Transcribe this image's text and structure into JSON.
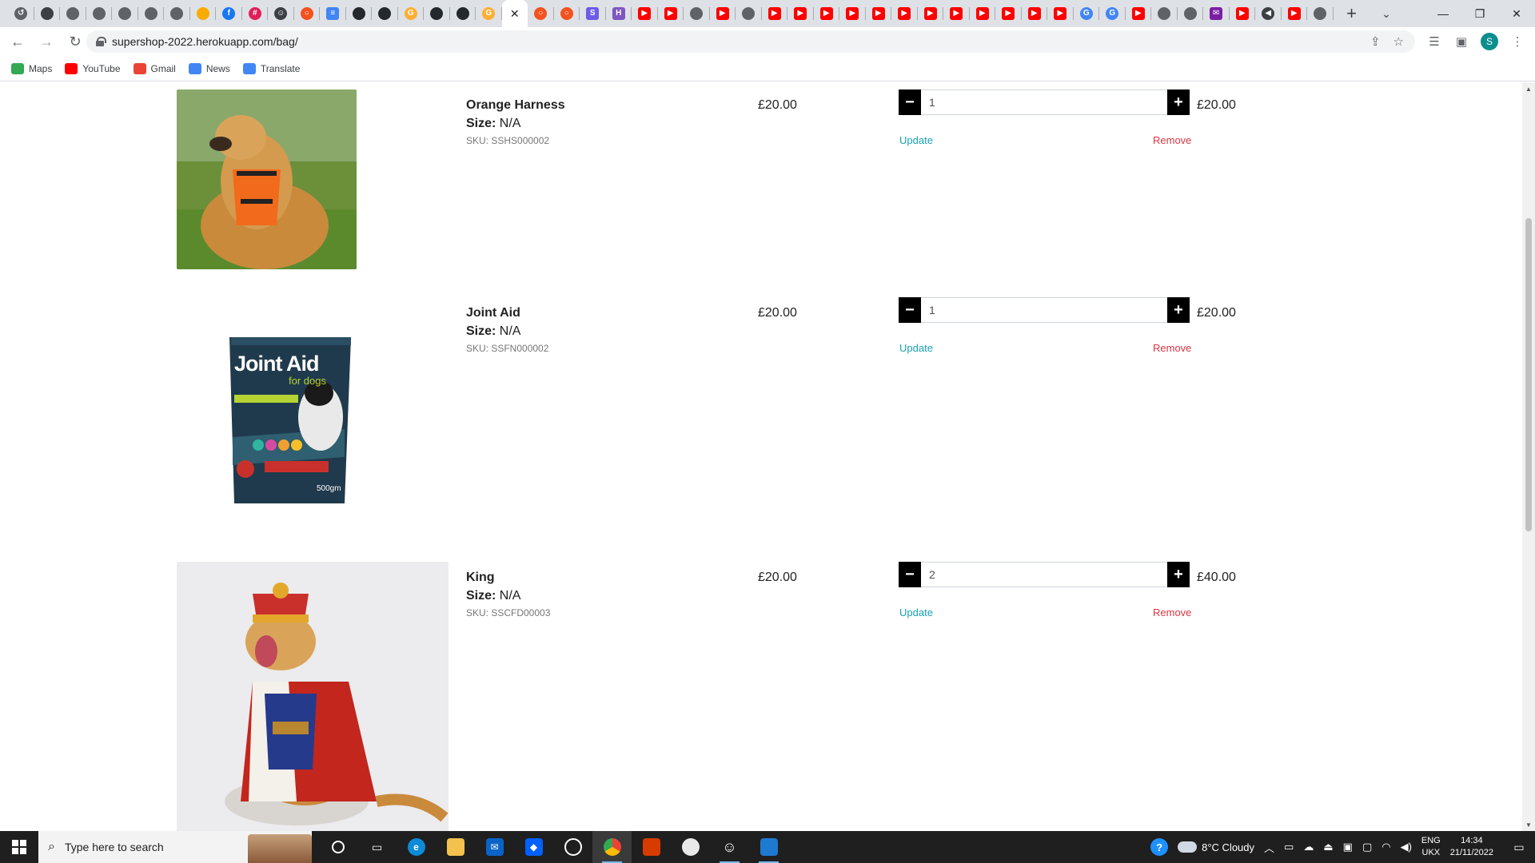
{
  "browser": {
    "tabs": [
      {
        "icon": "history-icon",
        "color": "#5f6368",
        "glyph": "↺"
      },
      {
        "icon": "circle-icon",
        "color": "#3c4043",
        "glyph": ""
      },
      {
        "icon": "chrome-gray-icon",
        "color": "#5f6368",
        "glyph": ""
      },
      {
        "icon": "chrome-gray-icon",
        "color": "#5f6368",
        "glyph": ""
      },
      {
        "icon": "chrome-gray-icon",
        "color": "#5f6368",
        "glyph": ""
      },
      {
        "icon": "chrome-gray-icon",
        "color": "#5f6368",
        "glyph": ""
      },
      {
        "icon": "chrome-gray-icon",
        "color": "#5f6368",
        "glyph": ""
      },
      {
        "icon": "orange-dot-icon",
        "color": "#f9ab00",
        "glyph": ""
      },
      {
        "icon": "facebook-icon",
        "color": "#1877f2",
        "glyph": "f"
      },
      {
        "icon": "slack-icon",
        "color": "#e01e5a",
        "glyph": "#"
      },
      {
        "icon": "smiley-icon",
        "color": "#3c4043",
        "glyph": "☺"
      },
      {
        "icon": "ring-orange-icon",
        "color": "#f4511e",
        "glyph": "○"
      },
      {
        "icon": "docs-icon",
        "color": "#4285f4",
        "glyph": "≡"
      },
      {
        "icon": "github-icon",
        "color": "#24292e",
        "glyph": ""
      },
      {
        "icon": "github-icon",
        "color": "#24292e",
        "glyph": ""
      },
      {
        "icon": "gitpod-icon",
        "color": "#ffae33",
        "glyph": "G"
      },
      {
        "icon": "github-icon",
        "color": "#24292e",
        "glyph": ""
      },
      {
        "icon": "github-icon",
        "color": "#24292e",
        "glyph": ""
      },
      {
        "icon": "gitpod-icon",
        "color": "#ffae33",
        "glyph": "G"
      },
      {
        "icon": "close-icon",
        "color": "#ffffff",
        "glyph": "✕",
        "active": true
      },
      {
        "icon": "ring-orange-icon",
        "color": "#f4511e",
        "glyph": "○"
      },
      {
        "icon": "ring-orange-icon",
        "color": "#f4511e",
        "glyph": "○"
      },
      {
        "icon": "s-icon",
        "color": "#6c5ce7",
        "glyph": "S"
      },
      {
        "icon": "h-icon",
        "color": "#7e57c2",
        "glyph": "H"
      },
      {
        "icon": "youtube-icon",
        "color": "#ff0000",
        "glyph": "▶"
      },
      {
        "icon": "youtube-icon",
        "color": "#ff0000",
        "glyph": "▶"
      },
      {
        "icon": "chrome-gray-icon",
        "color": "#5f6368",
        "glyph": ""
      },
      {
        "icon": "youtube-icon",
        "color": "#ff0000",
        "glyph": "▶"
      },
      {
        "icon": "chrome-gray-icon",
        "color": "#5f6368",
        "glyph": ""
      },
      {
        "icon": "youtube-icon",
        "color": "#ff0000",
        "glyph": "▶"
      },
      {
        "icon": "youtube-icon",
        "color": "#ff0000",
        "glyph": "▶"
      },
      {
        "icon": "youtube-icon",
        "color": "#ff0000",
        "glyph": "▶"
      },
      {
        "icon": "youtube-icon",
        "color": "#ff0000",
        "glyph": "▶"
      },
      {
        "icon": "youtube-icon",
        "color": "#ff0000",
        "glyph": "▶"
      },
      {
        "icon": "youtube-icon",
        "color": "#ff0000",
        "glyph": "▶"
      },
      {
        "icon": "youtube-icon",
        "color": "#ff0000",
        "glyph": "▶"
      },
      {
        "icon": "youtube-icon",
        "color": "#ff0000",
        "glyph": "▶"
      },
      {
        "icon": "youtube-icon",
        "color": "#ff0000",
        "glyph": "▶"
      },
      {
        "icon": "youtube-icon",
        "color": "#ff0000",
        "glyph": "▶"
      },
      {
        "icon": "youtube-icon",
        "color": "#ff0000",
        "glyph": "▶"
      },
      {
        "icon": "youtube-icon",
        "color": "#ff0000",
        "glyph": "▶"
      },
      {
        "icon": "google-icon",
        "color": "#4285f4",
        "glyph": "G"
      },
      {
        "icon": "google-icon",
        "color": "#4285f4",
        "glyph": "G"
      },
      {
        "icon": "youtube-icon",
        "color": "#ff0000",
        "glyph": "▶"
      },
      {
        "icon": "chrome-gray-icon",
        "color": "#5f6368",
        "glyph": ""
      },
      {
        "icon": "chrome-gray-icon",
        "color": "#5f6368",
        "glyph": ""
      },
      {
        "icon": "mail-purple-icon",
        "color": "#7b1fa2",
        "glyph": "✉"
      },
      {
        "icon": "youtube-icon",
        "color": "#ff0000",
        "glyph": "▶"
      },
      {
        "icon": "speaker-icon",
        "color": "#3c4043",
        "glyph": "◀"
      },
      {
        "icon": "youtube-icon",
        "color": "#ff0000",
        "glyph": "▶"
      },
      {
        "icon": "chrome-gray-icon",
        "color": "#5f6368",
        "glyph": ""
      }
    ],
    "url": "supershop-2022.herokuapp.com/bag/",
    "profile_initial": "S",
    "bookmarks": [
      {
        "label": "Maps",
        "icon": "maps-icon",
        "color": "#34a853"
      },
      {
        "label": "YouTube",
        "icon": "youtube-icon",
        "color": "#ff0000"
      },
      {
        "label": "Gmail",
        "icon": "gmail-icon",
        "color": "#ea4335"
      },
      {
        "label": "News",
        "icon": "news-icon",
        "color": "#4285f4"
      },
      {
        "label": "Translate",
        "icon": "translate-icon",
        "color": "#4285f4"
      }
    ]
  },
  "bag": {
    "items": [
      {
        "name": "Orange Harness",
        "size_label": "Size:",
        "size_value": "N/A",
        "sku": "SKU: SSHS000002",
        "price": "£20.00",
        "quantity": "1",
        "subtotal": "£20.00",
        "update_label": "Update",
        "remove_label": "Remove",
        "image": "orange-harness-dog-photo"
      },
      {
        "name": "Joint Aid",
        "size_label": "Size:",
        "size_value": "N/A",
        "sku": "SKU: SSFN000002",
        "price": "£20.00",
        "quantity": "1",
        "subtotal": "£20.00",
        "update_label": "Update",
        "remove_label": "Remove",
        "image": "joint-aid-package-photo",
        "package_title": "Joint Aid",
        "package_subtitle": "for dogs",
        "package_weight": "500gm"
      },
      {
        "name": "King",
        "size_label": "Size:",
        "size_value": "N/A",
        "sku": "SKU: SSCFD00003",
        "price": "£20.00",
        "quantity": "2",
        "subtotal": "£40.00",
        "update_label": "Update",
        "remove_label": "Remove",
        "image": "king-costume-dog-photo"
      }
    ],
    "minus_glyph": "−",
    "plus_glyph": "+"
  },
  "taskbar": {
    "search_placeholder": "Type here to search",
    "weather": "8°C  Cloudy",
    "lang_line1": "ENG",
    "lang_line2": "UKX",
    "time": "14:34",
    "date": "21/11/2022"
  }
}
